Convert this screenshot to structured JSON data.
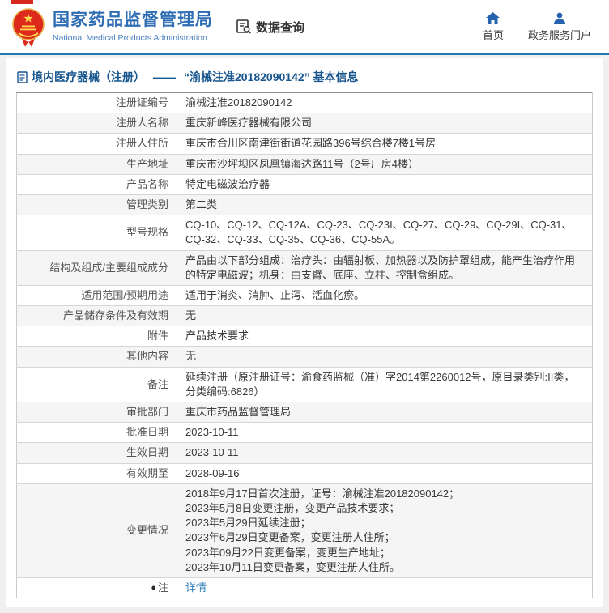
{
  "header": {
    "logo": {
      "title": "国家药品监督管理局",
      "subtitle": "National Medical Products Administration",
      "emblem_icon": "china-national-emblem",
      "emblem_red": "#de2a1c",
      "emblem_gold": "#ffd84d"
    },
    "data_query": {
      "label": "数据查询",
      "icon": "document-search-icon"
    },
    "nav": [
      {
        "label": "首页",
        "icon": "home-icon"
      },
      {
        "label": "政务服务门户",
        "icon": "user-icon"
      }
    ],
    "title_color": "#2e6db4",
    "border_color": "#2379ae"
  },
  "breadcrumb": {
    "icon": "document-icon",
    "section": "境内医疗器械（注册）",
    "separator": "——",
    "current": "“渝械注准20182090142” 基本信息"
  },
  "table": {
    "rows": [
      {
        "label": "注册证编号",
        "value": "渝械注准20182090142"
      },
      {
        "label": "注册人名称",
        "value": "重庆新峰医疗器械有限公司"
      },
      {
        "label": "注册人住所",
        "value": "重庆市合川区南津街街道花园路396号综合楼7楼1号房"
      },
      {
        "label": "生产地址",
        "value": "重庆市沙坪坝区凤凰镇海达路11号（2号厂房4楼）"
      },
      {
        "label": "产品名称",
        "value": "特定电磁波治疗器"
      },
      {
        "label": "管理类别",
        "value": "第二类"
      },
      {
        "label": "型号规格",
        "value": "CQ-10、CQ-12、CQ-12A、CQ-23、CQ-23I、CQ-27、CQ-29、CQ-29I、CQ-31、CQ-32、CQ-33、CQ-35、CQ-36、CQ-55A。"
      },
      {
        "label": "结构及组成/主要组成成分",
        "value": "产品由以下部分组成：治疗头：由辐射板、加热器以及防护罩组成，能产生治疗作用的特定电磁波；机身：由支臂、底座、立柱、控制盒组成。"
      },
      {
        "label": "适用范围/预期用途",
        "value": "适用于消炎、消肿、止泻、活血化瘀。"
      },
      {
        "label": "产品储存条件及有效期",
        "value": "无"
      },
      {
        "label": "附件",
        "value": "产品技术要求"
      },
      {
        "label": "其他内容",
        "value": "无"
      },
      {
        "label": "备注",
        "value": "延续注册（原注册证号：渝食药监械（准）字2014第2260012号，原目录类别:II类，分类编码:6826）"
      },
      {
        "label": "审批部门",
        "value": "重庆市药品监督管理局"
      },
      {
        "label": "批准日期",
        "value": "2023-10-11"
      },
      {
        "label": "生效日期",
        "value": "2023-10-11"
      },
      {
        "label": "有效期至",
        "value": "2028-09-16"
      },
      {
        "label": "变更情况",
        "value": [
          "2018年9月17日首次注册，证号：渝械注准20182090142；",
          "2023年5月8日变更注册，变更产品技术要求；",
          "2023年5月29日延续注册；",
          "2023年6月29日变更备案，变更注册人住所；",
          "2023年09月22日变更备案，变更生产地址；",
          "2023年10月11日变更备案，变更注册人住所。"
        ]
      },
      {
        "label": "注",
        "value": "详情",
        "link": true,
        "label_icon": "note-balloon-icon"
      }
    ]
  },
  "colors": {
    "stripe": "#f5f5f5",
    "table_border": "#cbcbcb",
    "breadcrumb_blue": "#17558e",
    "link_blue": "#2a7db7",
    "icon_blue": "#2563ae"
  }
}
